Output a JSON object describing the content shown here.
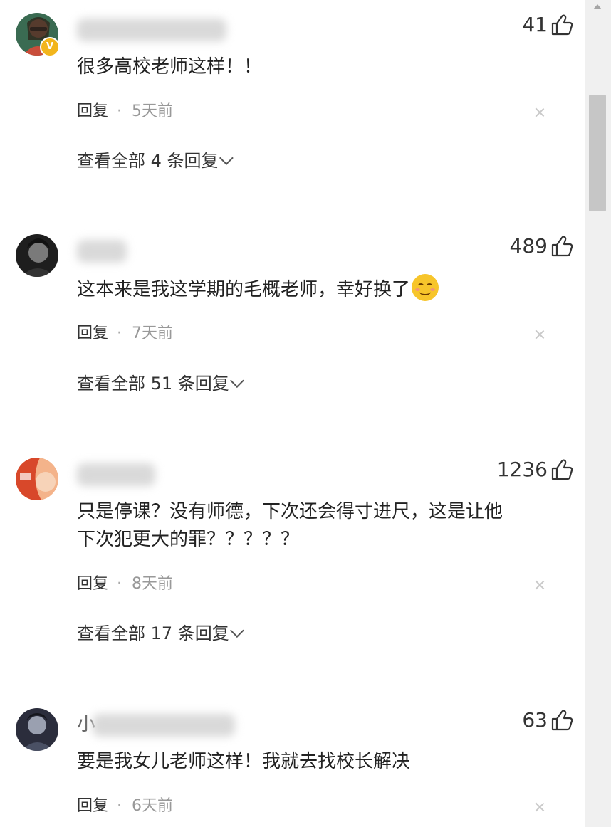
{
  "comments": [
    {
      "likes": "41",
      "text": "很多高校老师这样！！",
      "reply_label": "回复",
      "time": "5天前",
      "view_all": "查看全部 4 条回复",
      "verified": true,
      "avatar_colors": [
        "#3a6b52",
        "#b9826a"
      ]
    },
    {
      "likes": "489",
      "text": "这本来是我这学期的毛概老师，幸好换了",
      "reply_label": "回复",
      "time": "7天前",
      "view_all": "查看全部 51 条回复",
      "emoji": "smiling-blush-emoji",
      "avatar_colors": [
        "#1e1e1e",
        "#7a7a7a"
      ]
    },
    {
      "likes": "1236",
      "text_line1": "只是停课？没有师德，下次还会得寸进尺，这是让他",
      "text_line2": "下次犯更大的罪？？？？？",
      "reply_label": "回复",
      "time": "8天前",
      "view_all": "查看全部 17 条回复",
      "avatar_colors": [
        "#d8482a",
        "#f4b38a"
      ]
    },
    {
      "likes": "63",
      "username_prefix": "小",
      "text": "要是我女儿老师这样！我就去找校长解决",
      "reply_label": "回复",
      "time": "6天前",
      "avatar_colors": [
        "#2b2d3c",
        "#9aa0b0"
      ]
    }
  ],
  "icons": {
    "like": "thumbs-up-icon",
    "close": "close-icon",
    "expand": "chevron-down-icon"
  }
}
